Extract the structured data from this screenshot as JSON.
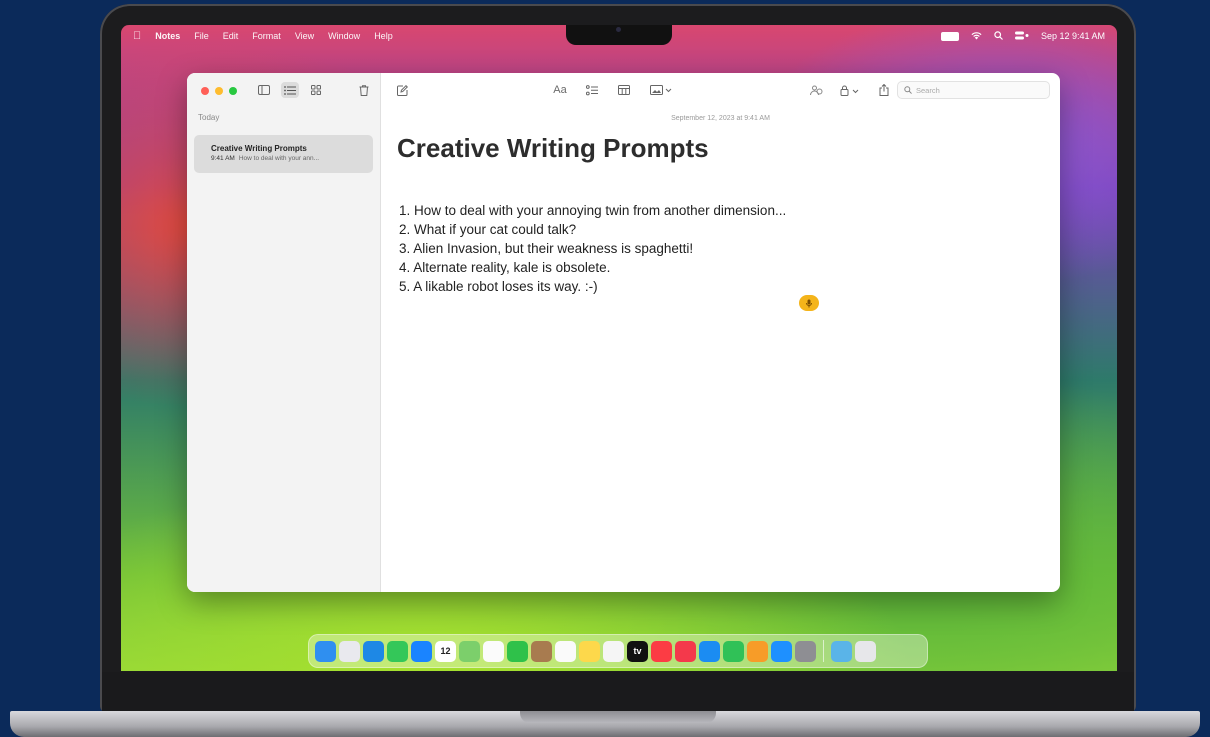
{
  "menubar": {
    "apple": "",
    "app": "Notes",
    "menus": [
      "File",
      "Edit",
      "Format",
      "View",
      "Window",
      "Help"
    ],
    "clock": "Sep 12  9:41 AM"
  },
  "sidebar": {
    "section": "Today",
    "note": {
      "title": "Creative Writing Prompts",
      "time": "9:41 AM",
      "preview": "How to deal with your ann..."
    }
  },
  "toolbar": {
    "format_label": "Aa",
    "search_placeholder": "Search"
  },
  "note": {
    "date": "September 12, 2023 at 9:41 AM",
    "title": "Creative Writing Prompts",
    "items": [
      "1. How to deal with your annoying twin from another dimension...",
      "2. What if your cat could talk?",
      "3. Alien Invasion, but their weakness is spaghetti!",
      "4. Alternate reality, kale is obsolete.",
      "5. A likable robot loses its way. :-)"
    ]
  },
  "dock": {
    "icons": [
      {
        "name": "finder-icon",
        "color": "#2f8ff0"
      },
      {
        "name": "launchpad-icon",
        "color": "#e9e9ee"
      },
      {
        "name": "safari-icon",
        "color": "#1e88e5"
      },
      {
        "name": "messages-icon",
        "color": "#34c759"
      },
      {
        "name": "mail-icon",
        "color": "#1a84ff"
      },
      {
        "name": "calendar-icon",
        "color": "#ffffff",
        "text": "12"
      },
      {
        "name": "maps-icon",
        "color": "#7ccf6b"
      },
      {
        "name": "photos-icon",
        "color": "#fbfbfb"
      },
      {
        "name": "facetime-icon",
        "color": "#2fc14a"
      },
      {
        "name": "contacts-icon",
        "color": "#a87b4f"
      },
      {
        "name": "reminders-icon",
        "color": "#fafafa"
      },
      {
        "name": "notes-icon",
        "color": "#fdd84b"
      },
      {
        "name": "freeform-icon",
        "color": "#f5f5f5"
      },
      {
        "name": "tv-icon",
        "color": "#111111",
        "text": "tv"
      },
      {
        "name": "music-icon",
        "color": "#fc3c44"
      },
      {
        "name": "news-icon",
        "color": "#f4394b"
      },
      {
        "name": "keynote-icon",
        "color": "#1b8cf2"
      },
      {
        "name": "numbers-icon",
        "color": "#30c157"
      },
      {
        "name": "pages-icon",
        "color": "#f79c28"
      },
      {
        "name": "app-store-icon",
        "color": "#1e90ff"
      },
      {
        "name": "system-settings-icon",
        "color": "#8e8e93"
      }
    ],
    "trailing": [
      {
        "name": "downloads-folder-icon",
        "color": "#5ab4e8"
      },
      {
        "name": "trash-icon",
        "color": "#e7e7ea"
      }
    ]
  }
}
